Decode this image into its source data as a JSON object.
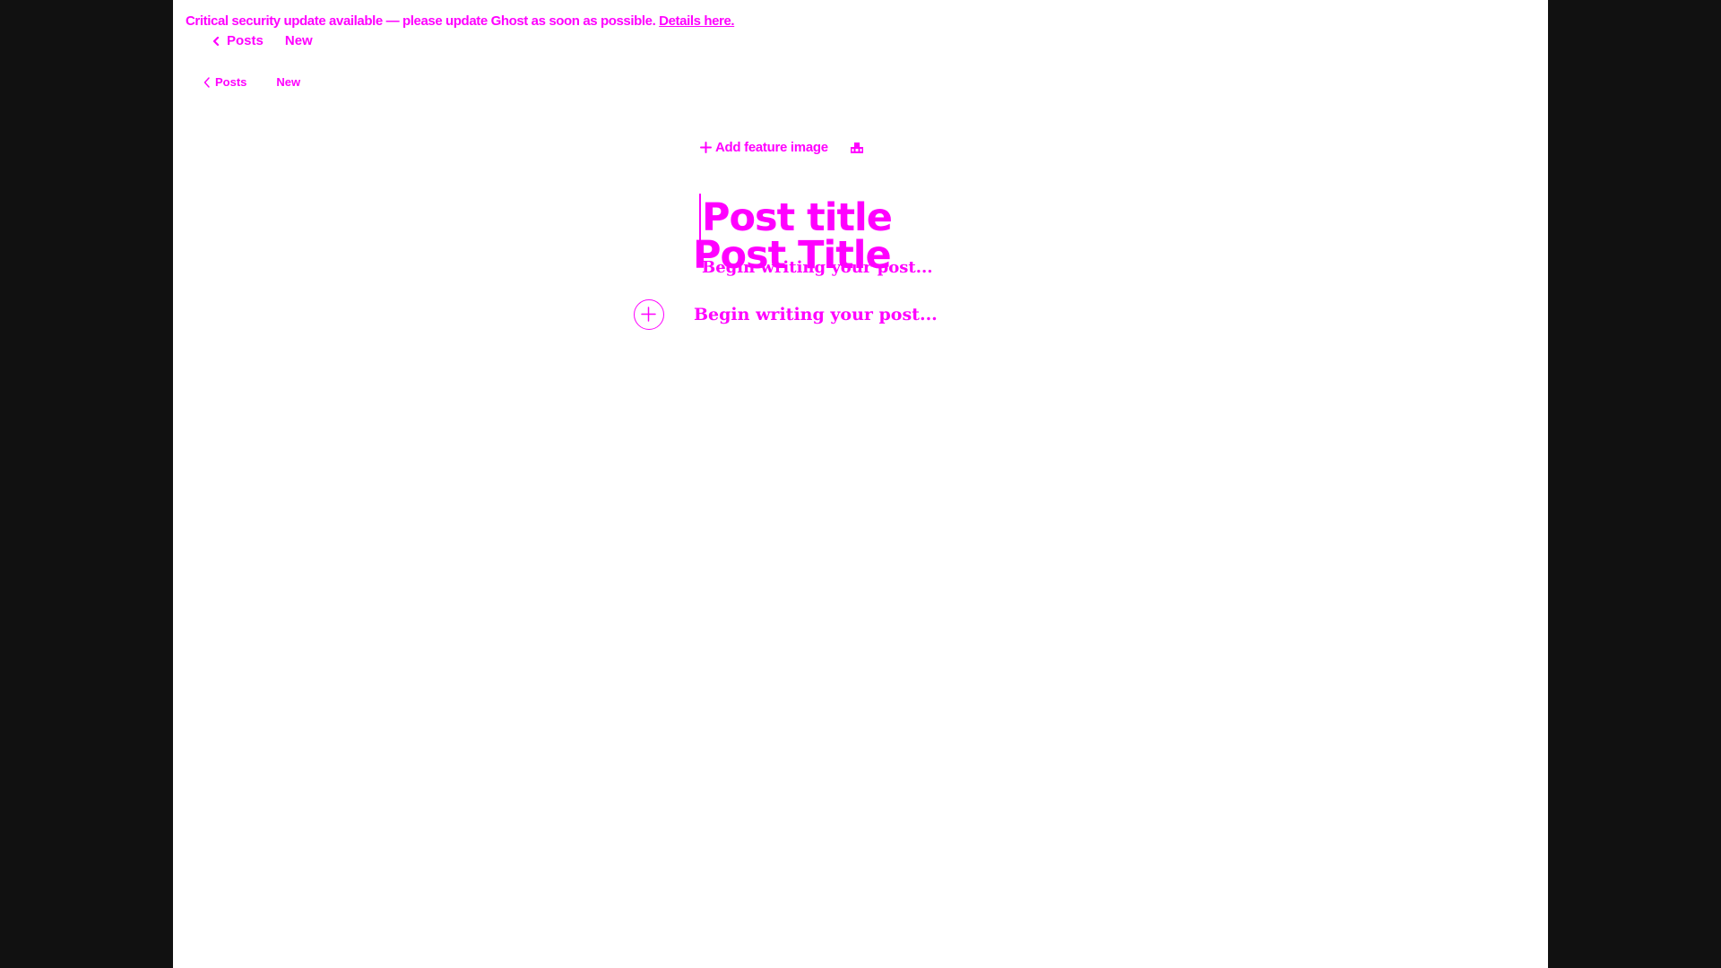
{
  "alert": {
    "message": "Critical security update available — please update Ghost as soon as possible.",
    "link_label": "Details here."
  },
  "nav": {
    "back_label": "Posts",
    "status_label": "New"
  },
  "nav_secondary": {
    "back_label": "Posts",
    "status_label": "New"
  },
  "feature_image": {
    "add_label": "Add feature image",
    "icon": "image-upload-icon"
  },
  "editor": {
    "title_placeholder": "Post title",
    "ghost_title": "Post Title",
    "ghost_body": "Begin writing your post...",
    "body_placeholder": "Begin writing your post...",
    "add_card_icon": "plus-circle-icon"
  },
  "colors": {
    "accent": "#ff00ff",
    "background": "#ffffff",
    "outer": "#111111"
  }
}
